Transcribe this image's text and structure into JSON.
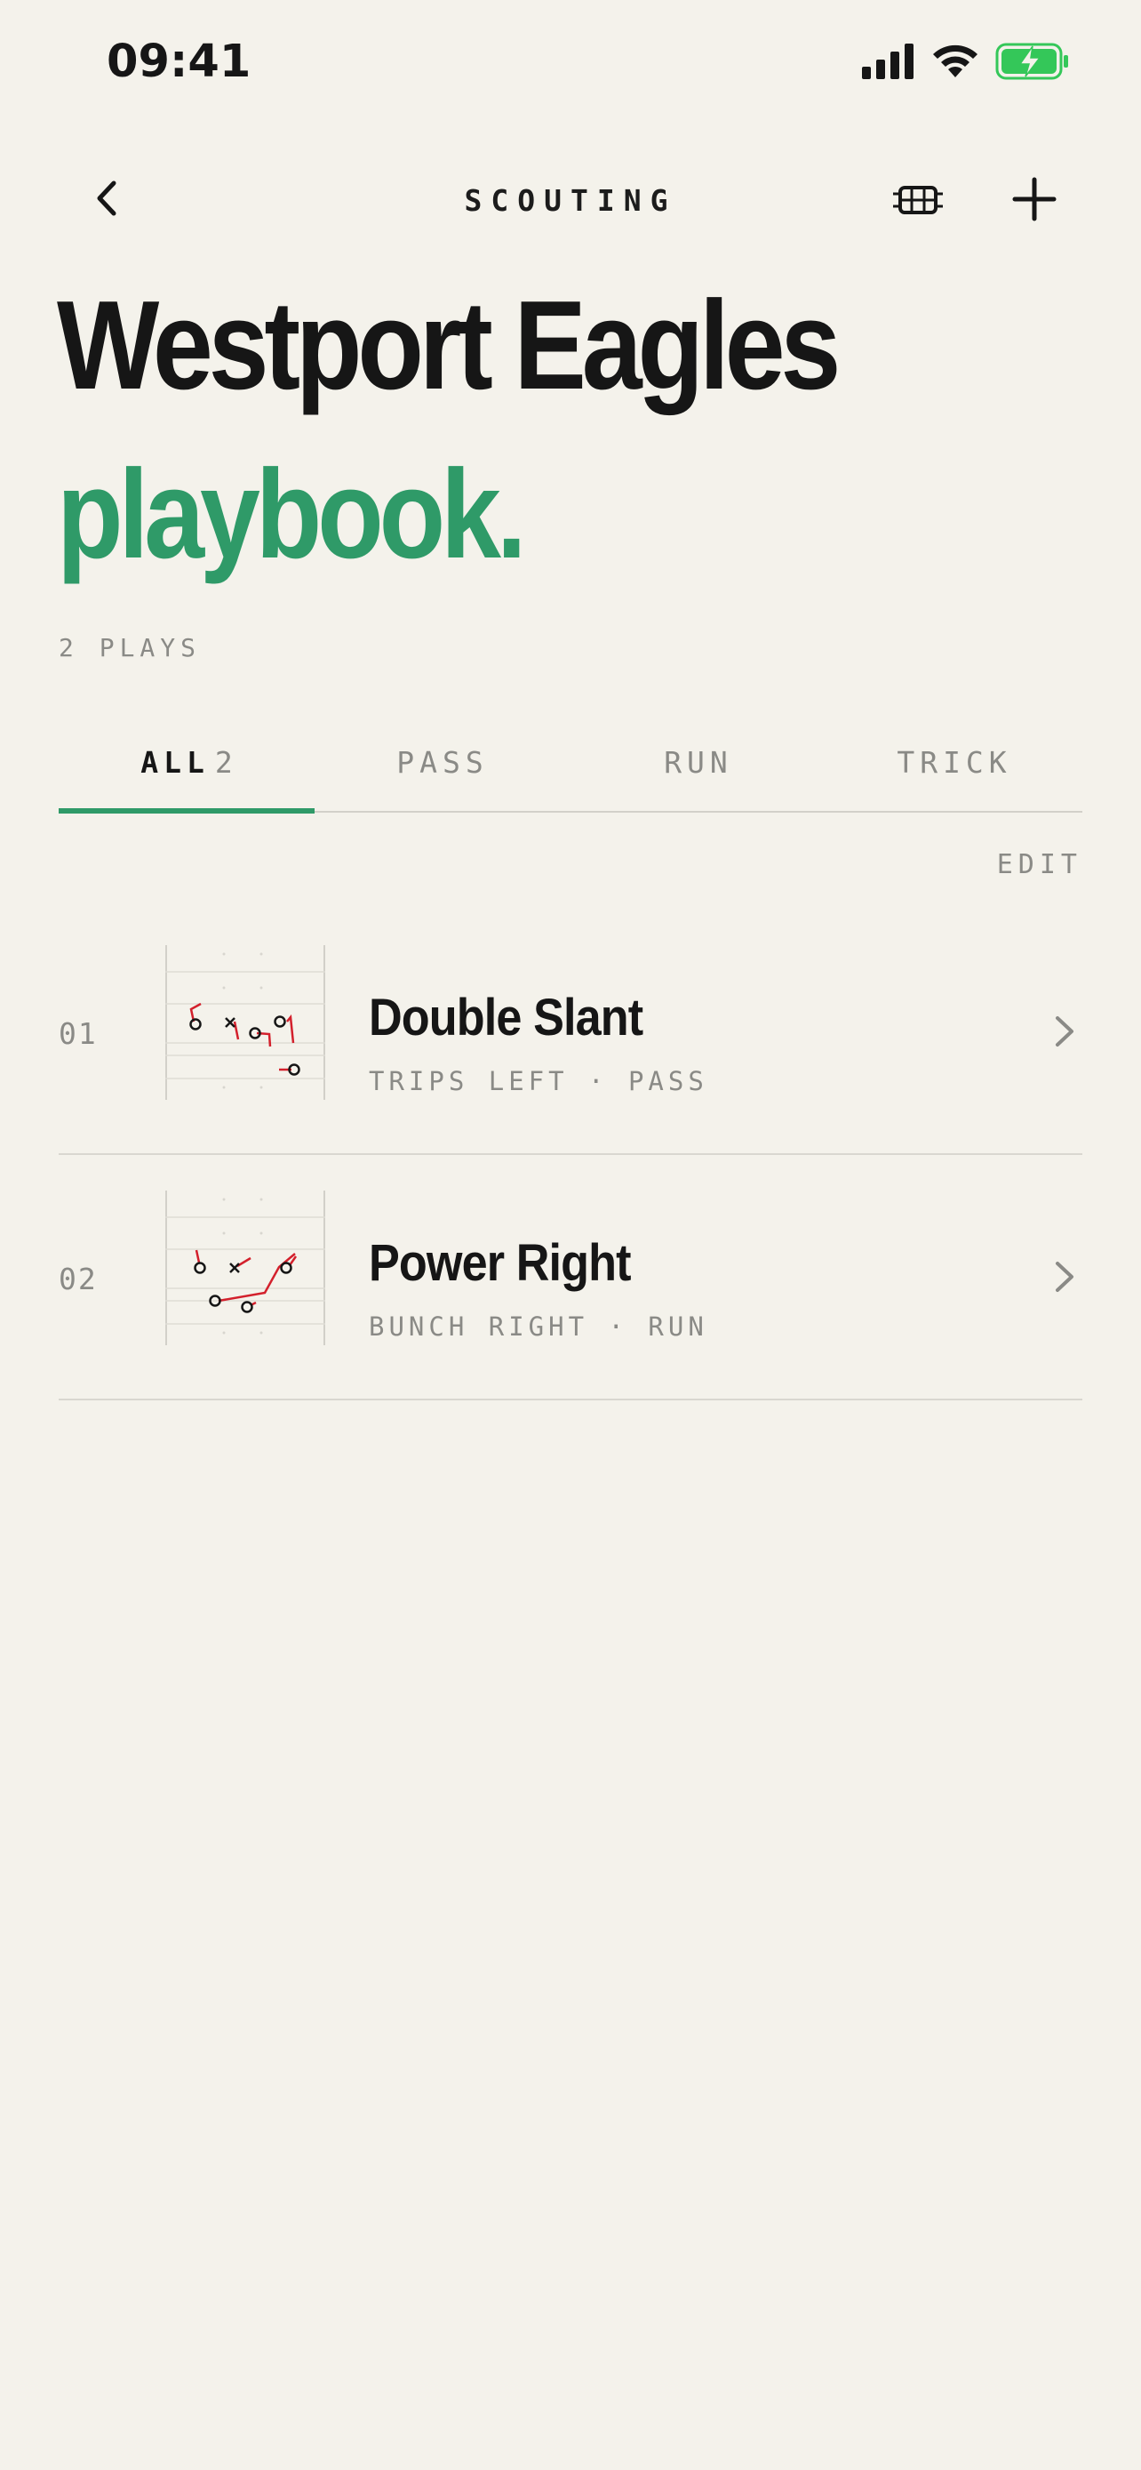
{
  "status_bar": {
    "time": "09:41"
  },
  "nav": {
    "title": "SCOUTING"
  },
  "hero": {
    "team": "Westport Eagles",
    "subtitle": "playbook.",
    "plays_count": "2 PLAYS"
  },
  "tabs": [
    {
      "label": "ALL",
      "count": "2",
      "active": true
    },
    {
      "label": "PASS",
      "count": "",
      "active": false
    },
    {
      "label": "RUN",
      "count": "",
      "active": false
    },
    {
      "label": "TRICK",
      "count": "",
      "active": false
    }
  ],
  "edit_label": "EDIT",
  "plays": [
    {
      "number": "01",
      "name": "Double Slant",
      "formation": "TRIPS LEFT",
      "type": "PASS",
      "meta": "TRIPS LEFT · PASS"
    },
    {
      "number": "02",
      "name": "Power Right",
      "formation": "BUNCH RIGHT",
      "type": "RUN",
      "meta": "BUNCH RIGHT · RUN"
    }
  ],
  "colors": {
    "accent": "#2f9a68",
    "background": "#f4f2eb",
    "route": "#d3202c",
    "muted": "#8a8a86",
    "battery": "#34c759"
  }
}
